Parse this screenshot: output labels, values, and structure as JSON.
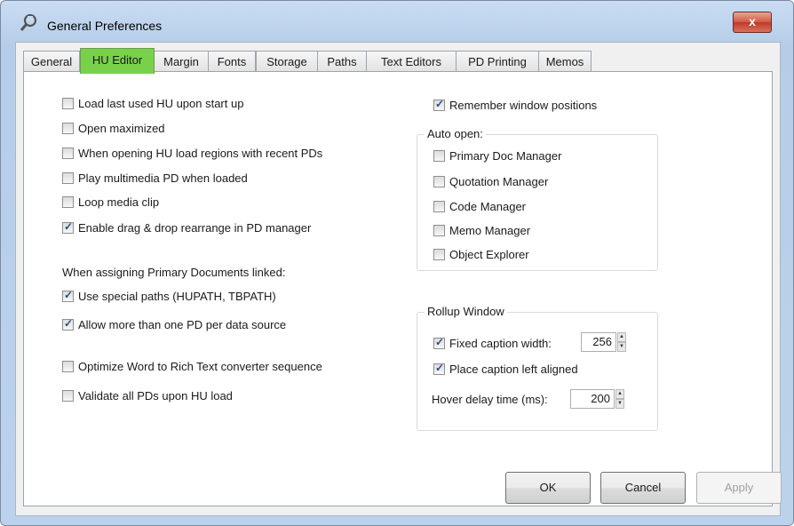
{
  "window": {
    "title": "General Preferences",
    "close_label": "x"
  },
  "tabs": [
    {
      "label": "General"
    },
    {
      "label": "HU Editor"
    },
    {
      "label": "Margin"
    },
    {
      "label": "Fonts"
    },
    {
      "label": "Storage"
    },
    {
      "label": "Paths"
    },
    {
      "label": "Text Editors"
    },
    {
      "label": "PD Printing"
    },
    {
      "label": "Memos"
    }
  ],
  "active_tab": "HU Editor",
  "left": {
    "options": [
      {
        "label": "Load last used HU upon start up",
        "checked": false
      },
      {
        "label": "Open maximized",
        "checked": false
      },
      {
        "label": "When opening HU load regions with recent PDs",
        "checked": false
      },
      {
        "label": "Play multimedia PD when loaded",
        "checked": false
      },
      {
        "label": "Loop media clip",
        "checked": false
      },
      {
        "label": "Enable drag & drop rearrange  in PD manager",
        "checked": true
      }
    ],
    "assign_heading": "When assigning Primary Documents linked:",
    "assign_options": [
      {
        "label": "Use special paths (HUPATH, TBPATH)",
        "checked": true
      },
      {
        "label": "Allow more than one PD per data source",
        "checked": true
      }
    ],
    "optimize": {
      "label": "Optimize Word to Rich Text converter sequence",
      "checked": false
    },
    "validate": {
      "label": "Validate all PDs upon HU load",
      "checked": false
    }
  },
  "right": {
    "remember": {
      "label": "Remember window positions",
      "checked": true
    },
    "auto_open": {
      "title": "Auto open:",
      "items": [
        {
          "label": "Primary Doc Manager",
          "checked": false
        },
        {
          "label": "Quotation Manager",
          "checked": false
        },
        {
          "label": "Code Manager",
          "checked": false
        },
        {
          "label": "Memo Manager",
          "checked": false
        },
        {
          "label": "Object Explorer",
          "checked": false
        }
      ]
    },
    "rollup": {
      "title": "Rollup Window",
      "fixed_caption": {
        "label": "Fixed caption width:",
        "checked": true,
        "value": "256"
      },
      "place_caption": {
        "label": "Place caption left aligned",
        "checked": true
      },
      "hover_delay": {
        "label": "Hover delay time (ms):",
        "value": "200"
      }
    }
  },
  "buttons": {
    "ok": "OK",
    "cancel": "Cancel",
    "apply": "Apply"
  }
}
